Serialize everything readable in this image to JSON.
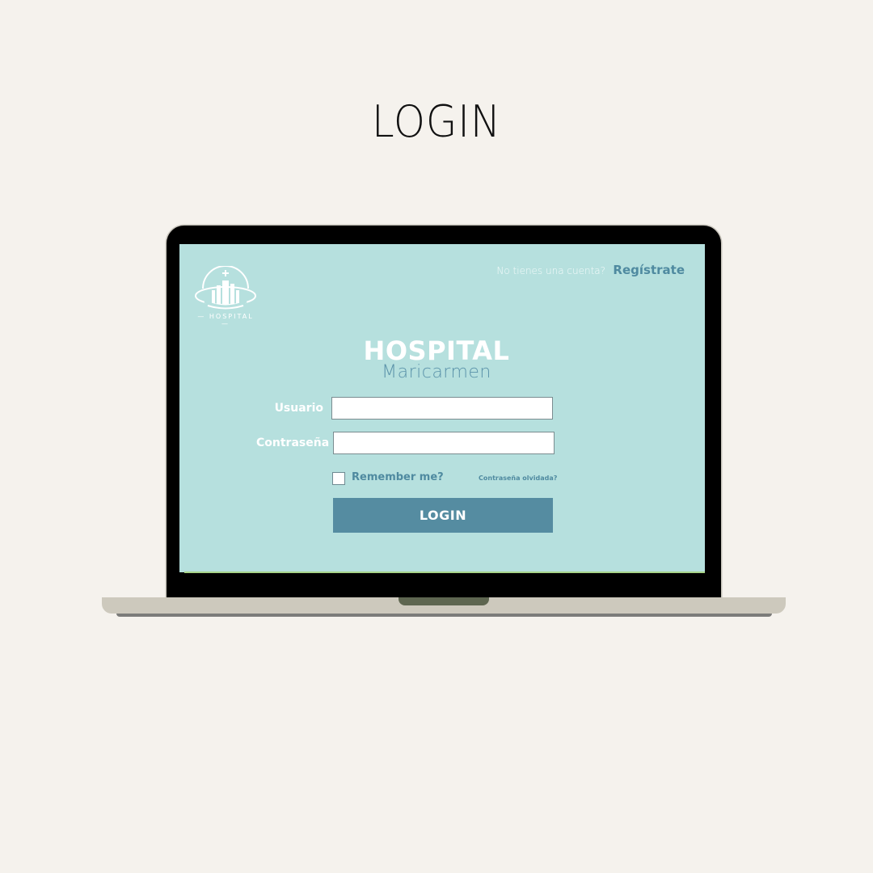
{
  "heading": "LOGIN",
  "logo": {
    "text": "— HOSPITAL —"
  },
  "header": {
    "signup_prompt": "No tienes una cuenta?",
    "signup_link": "Regístrate"
  },
  "brand": {
    "title": "HOSPITAL",
    "subtitle": "Maricarmen"
  },
  "form": {
    "username_label": "Usuario",
    "username_value": "",
    "password_label": "Contraseña",
    "password_value": "",
    "remember_label": "Remember me?",
    "remember_checked": false,
    "forgot_link": "Contraseña olvidada?",
    "submit_label": "LOGIN"
  },
  "colors": {
    "background": "#f5f2ed",
    "screen": "#b6e0de",
    "accent": "#558ca1",
    "link": "#4f8aa0"
  }
}
